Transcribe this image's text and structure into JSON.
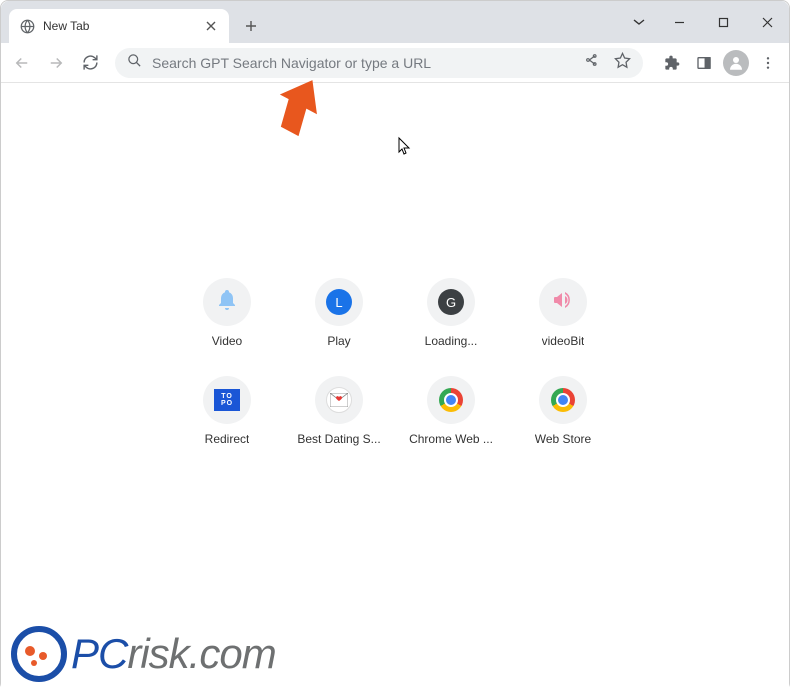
{
  "tab": {
    "title": "New Tab"
  },
  "omnibox": {
    "placeholder": "Search GPT Search Navigator or type a URL"
  },
  "shortcuts": [
    {
      "label": "Video",
      "icon": "bell"
    },
    {
      "label": "Play",
      "icon": "letter",
      "letter": "L",
      "color": "blue"
    },
    {
      "label": "Loading...",
      "icon": "letter",
      "letter": "G",
      "color": "dark"
    },
    {
      "label": "videoBit",
      "icon": "horn"
    },
    {
      "label": "Redirect",
      "icon": "topo"
    },
    {
      "label": "Best Dating S...",
      "icon": "envelope"
    },
    {
      "label": "Chrome Web ...",
      "icon": "chrome"
    },
    {
      "label": "Web Store",
      "icon": "chrome"
    }
  ],
  "watermark": {
    "text_prefix": "PC",
    "text_suffix": "risk.com"
  }
}
